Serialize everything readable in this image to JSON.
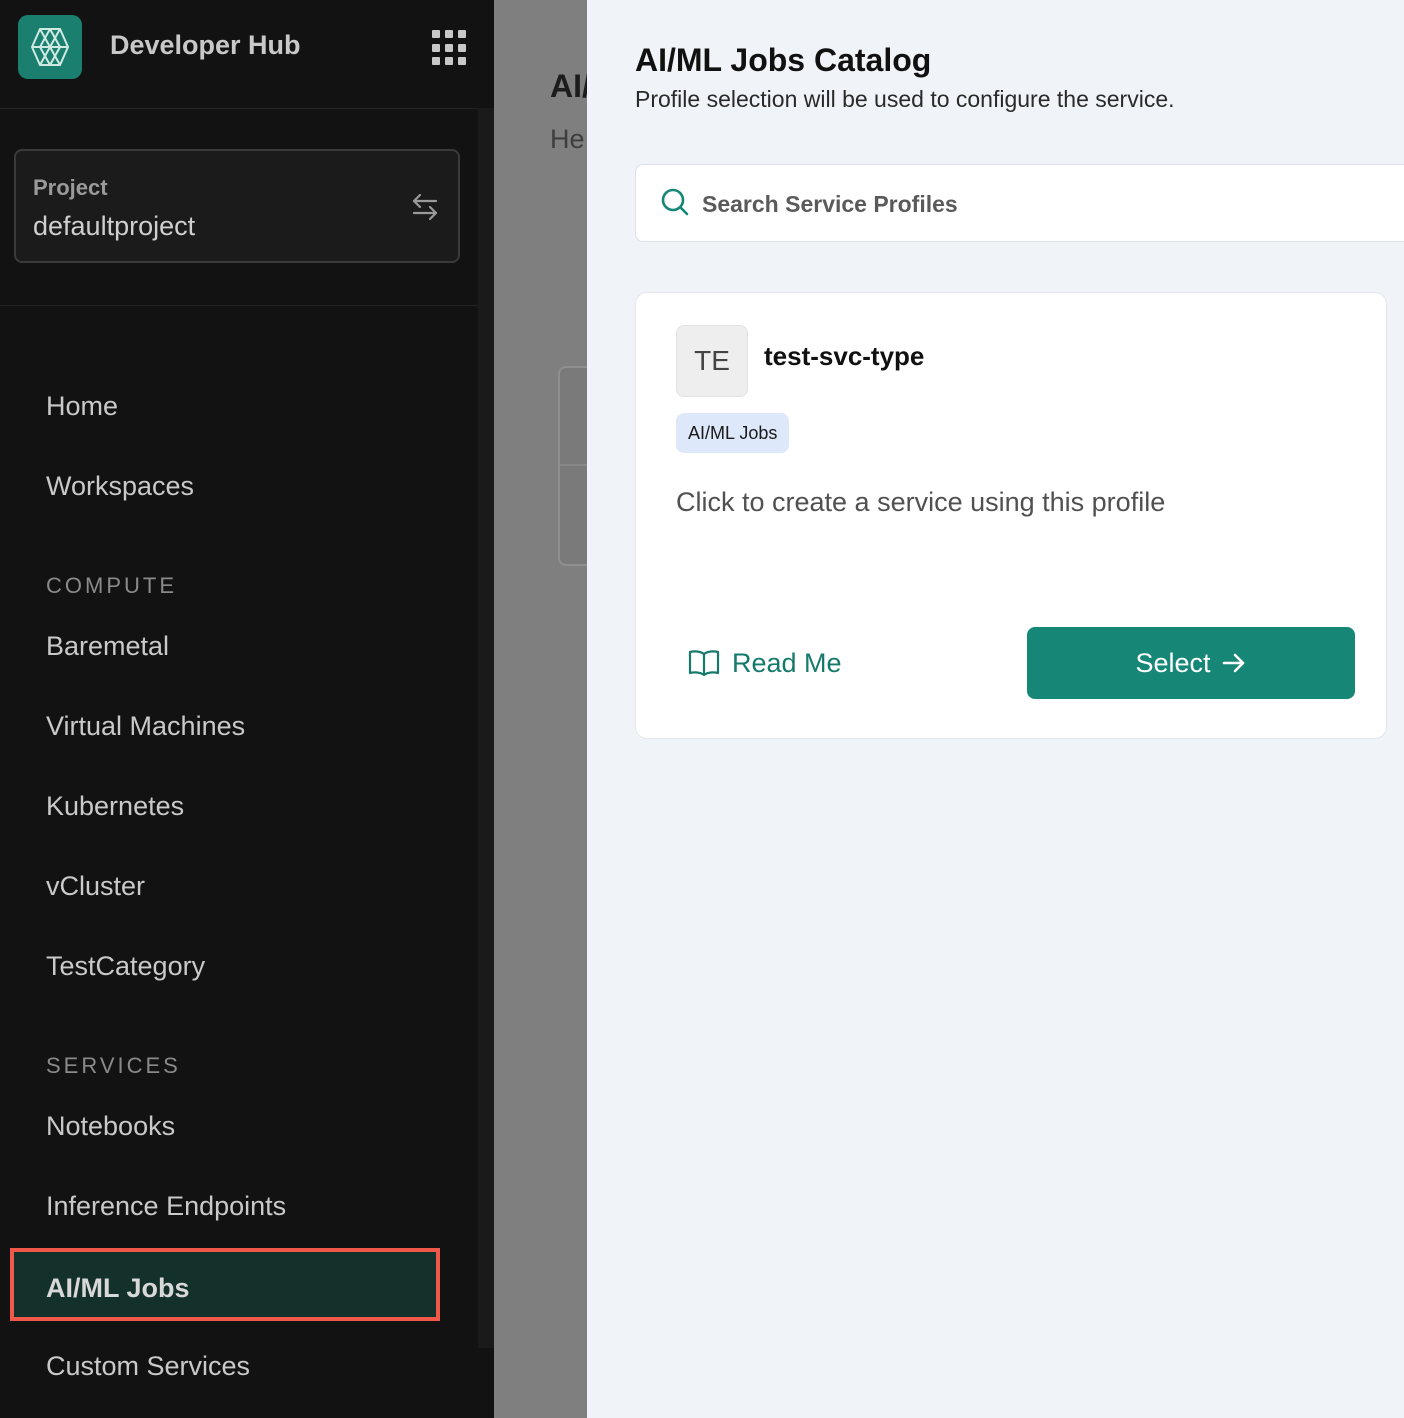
{
  "header": {
    "app_title": "Developer Hub",
    "apps_icon": "grid-apps-icon",
    "logo_icon": "lattice-logo-icon"
  },
  "project": {
    "label": "Project",
    "value": "defaultproject",
    "switch_icon": "swap-arrows-icon"
  },
  "nav": {
    "home": "Home",
    "workspaces": "Workspaces",
    "compute_label": "COMPUTE",
    "compute": [
      "Baremetal",
      "Virtual Machines",
      "Kubernetes",
      "vCluster",
      "TestCategory"
    ],
    "services_label": "SERVICES",
    "services": [
      "Notebooks",
      "Inference Endpoints",
      "AI/ML Jobs",
      "Custom Services"
    ],
    "active": "AI/ML Jobs"
  },
  "background_page": {
    "title_fragment": "AI/",
    "subtitle_fragment": "He"
  },
  "drawer": {
    "title": "AI/ML Jobs Catalog",
    "subtitle": "Profile selection will be used to configure the service.",
    "search_placeholder": "Search Service Profiles"
  },
  "profiles": [
    {
      "initials": "TE",
      "name": "test-svc-type",
      "tag": "AI/ML Jobs",
      "description": "Click to create a service using this profile",
      "readme_label": "Read Me",
      "select_label": "Select"
    }
  ],
  "colors": {
    "accent": "#168676",
    "sidebar_bg": "#121212",
    "highlight_border": "#f0584a",
    "drawer_bg": "#f0f3f8"
  }
}
